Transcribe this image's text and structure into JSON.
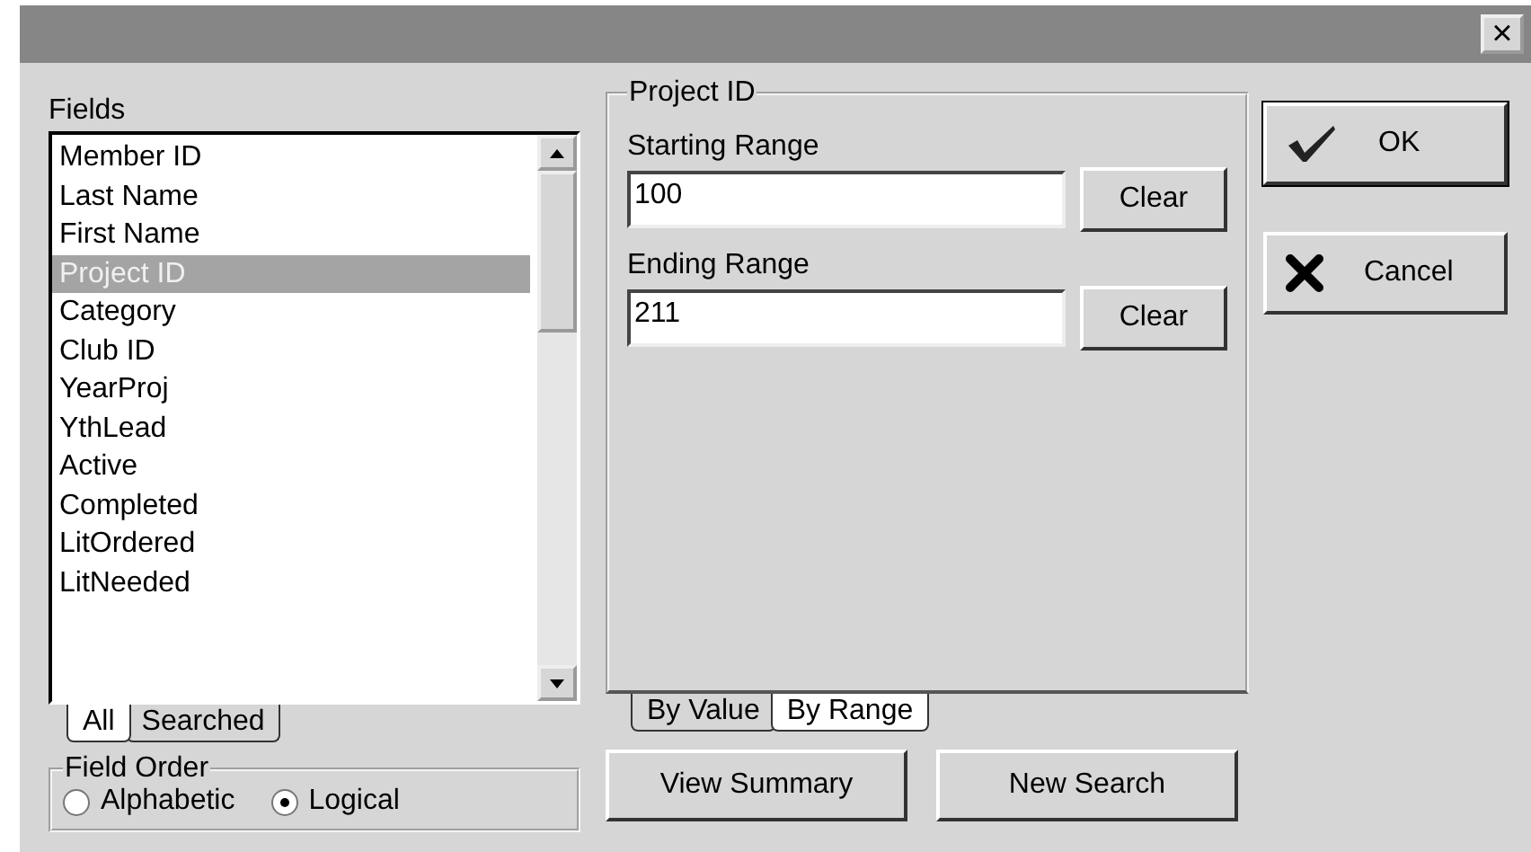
{
  "window": {
    "close": "×"
  },
  "fields": {
    "label": "Fields",
    "items": [
      {
        "label": "Member ID",
        "selected": false
      },
      {
        "label": "Last Name",
        "selected": false
      },
      {
        "label": "First Name",
        "selected": false
      },
      {
        "label": "Project ID",
        "selected": true
      },
      {
        "label": "Category",
        "selected": false
      },
      {
        "label": "Club ID",
        "selected": false
      },
      {
        "label": "YearProj",
        "selected": false
      },
      {
        "label": "YthLead",
        "selected": false
      },
      {
        "label": "Active",
        "selected": false
      },
      {
        "label": "Completed",
        "selected": false
      },
      {
        "label": "LitOrdered",
        "selected": false
      },
      {
        "label": "LitNeeded",
        "selected": false
      }
    ],
    "tabs": [
      {
        "label": "All",
        "selected": true
      },
      {
        "label": "Searched",
        "selected": false
      }
    ]
  },
  "field_order": {
    "title": "Field Order",
    "options": [
      {
        "label": "Alphabetic",
        "selected": false
      },
      {
        "label": "Logical",
        "selected": true
      }
    ]
  },
  "range_panel": {
    "title": "Project ID",
    "ranges": [
      {
        "label": "Starting Range",
        "value": "100",
        "clear": "Clear"
      },
      {
        "label": "Ending Range",
        "value": "211",
        "clear": "Clear"
      }
    ],
    "tabs": [
      {
        "label": "By Value",
        "selected": false
      },
      {
        "label": "By Range",
        "selected": true
      }
    ]
  },
  "buttons": [
    {
      "kind": "ok",
      "label": "OK"
    },
    {
      "kind": "cancel",
      "label": "Cancel"
    }
  ],
  "bottom_buttons": [
    "View Summary",
    "New Search"
  ]
}
